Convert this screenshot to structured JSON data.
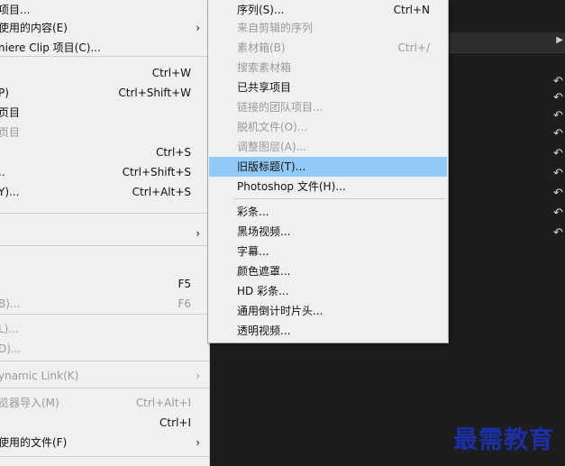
{
  "left_menu": {
    "items": [
      {
        "label": "项目...",
        "shortcut": "",
        "arrow": false,
        "disabled": false
      },
      {
        "label": "使用的内容(E)",
        "shortcut": "",
        "arrow": true,
        "disabled": false
      },
      {
        "label": "niere Clip 项目(C)...",
        "shortcut": "",
        "arrow": false,
        "disabled": false
      },
      {
        "label": "",
        "shortcut": "Ctrl+W",
        "arrow": false,
        "disabled": false
      },
      {
        "label": "P)",
        "shortcut": "Ctrl+Shift+W",
        "arrow": false,
        "disabled": false
      },
      {
        "label": "页目",
        "shortcut": "",
        "arrow": false,
        "disabled": false
      },
      {
        "label": "页目",
        "shortcut": "",
        "arrow": false,
        "disabled": true
      },
      {
        "label": "",
        "shortcut": "Ctrl+S",
        "arrow": false,
        "disabled": false
      },
      {
        "label": "..",
        "shortcut": "Ctrl+Shift+S",
        "arrow": false,
        "disabled": false
      },
      {
        "label": "Y)...",
        "shortcut": "Ctrl+Alt+S",
        "arrow": false,
        "disabled": false
      },
      {
        "label": "",
        "shortcut": "",
        "arrow": true,
        "disabled": false
      },
      {
        "label": "",
        "shortcut": "F5",
        "arrow": false,
        "disabled": false
      },
      {
        "label": "B)...",
        "shortcut": "F6",
        "arrow": false,
        "disabled": true
      },
      {
        "label": "L)...",
        "shortcut": "",
        "arrow": false,
        "disabled": true
      },
      {
        "label": "D)...",
        "shortcut": "",
        "arrow": false,
        "disabled": true
      },
      {
        "label": "ynamic Link(K)",
        "shortcut": "",
        "arrow": true,
        "disabled": true
      },
      {
        "label": "览器导入(M)",
        "shortcut": "Ctrl+Alt+I",
        "arrow": false,
        "disabled": true
      },
      {
        "label": "",
        "shortcut": "Ctrl+I",
        "arrow": false,
        "disabled": false
      },
      {
        "label": "使用的文件(F)",
        "shortcut": "",
        "arrow": true,
        "disabled": false
      }
    ]
  },
  "submenu": {
    "items": [
      {
        "label": "序列(S)...",
        "shortcut": "Ctrl+N",
        "disabled": false,
        "highlighted": false
      },
      {
        "label": "来自剪辑的序列",
        "shortcut": "",
        "disabled": true,
        "highlighted": false
      },
      {
        "label": "素材箱(B)",
        "shortcut": "Ctrl+/",
        "disabled": true,
        "highlighted": false
      },
      {
        "label": "搜索素材箱",
        "shortcut": "",
        "disabled": true,
        "highlighted": false
      },
      {
        "label": "已共享项目",
        "shortcut": "",
        "disabled": false,
        "highlighted": false
      },
      {
        "label": "链接的团队项目...",
        "shortcut": "",
        "disabled": true,
        "highlighted": false
      },
      {
        "label": "脱机文件(O)...",
        "shortcut": "",
        "disabled": true,
        "highlighted": false
      },
      {
        "label": "调整图层(A)...",
        "shortcut": "",
        "disabled": true,
        "highlighted": false
      },
      {
        "label": "旧版标题(T)...",
        "shortcut": "",
        "disabled": false,
        "highlighted": true
      },
      {
        "label": "Photoshop 文件(H)...",
        "shortcut": "",
        "disabled": false,
        "highlighted": false
      },
      {
        "label": "彩条...",
        "shortcut": "",
        "disabled": false,
        "highlighted": false
      },
      {
        "label": "黑场视频...",
        "shortcut": "",
        "disabled": false,
        "highlighted": false
      },
      {
        "label": "字幕...",
        "shortcut": "",
        "disabled": false,
        "highlighted": false
      },
      {
        "label": "颜色遮罩...",
        "shortcut": "",
        "disabled": false,
        "highlighted": false
      },
      {
        "label": "HD 彩条...",
        "shortcut": "",
        "disabled": false,
        "highlighted": false
      },
      {
        "label": "通用倒计时片头...",
        "shortcut": "",
        "disabled": false,
        "highlighted": false
      },
      {
        "label": "透明视频...",
        "shortcut": "",
        "disabled": false,
        "highlighted": false
      }
    ]
  },
  "icons": {
    "submenu_arrow": "chevron-right-icon",
    "reset": "reset-icon",
    "panel_menu": "chevron-right-icon"
  },
  "colors": {
    "highlight": "#91c9f7",
    "menu_bg": "#f0f0f0",
    "app_bg": "#1d1d1d",
    "watermark": "#1b2fa6"
  },
  "watermark": {
    "text": "最需教育"
  }
}
